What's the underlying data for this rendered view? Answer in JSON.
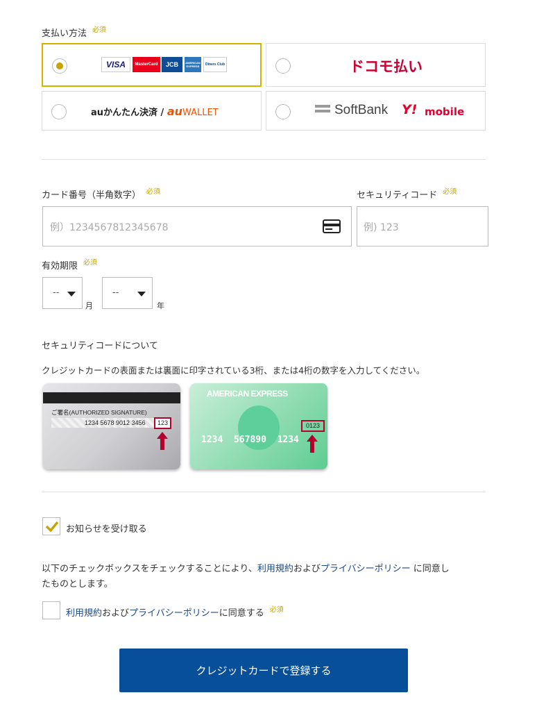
{
  "payment": {
    "title": "支払い方法",
    "required": "必須",
    "options": [
      {
        "id": "credit",
        "logos": [
          "VISA",
          "MasterCard",
          "JCB",
          "AMERICAN EXPRESS",
          "Diners Club"
        ],
        "selected": true
      },
      {
        "id": "docomo",
        "label": "ドコモ払い",
        "selected": false
      },
      {
        "id": "au",
        "label_a": "auかんたん決済 / ",
        "label_b": "au",
        "label_c": "WALLET",
        "selected": false
      },
      {
        "id": "softbank",
        "label_a": "SoftBank",
        "label_b": "Y!",
        "label_c": "mobile",
        "selected": false
      }
    ]
  },
  "card_number": {
    "label": "カード番号（半角数字）",
    "required": "必須",
    "placeholder": "例）1234567812345678"
  },
  "security_code": {
    "label": "セキュリティコード",
    "required": "必須",
    "placeholder": "例) 123"
  },
  "expiry": {
    "label": "有効期限",
    "required": "必須",
    "month_value": "--",
    "month_unit": "月",
    "year_value": "--",
    "year_unit": "年"
  },
  "security_info": {
    "title": "セキュリティコードについて",
    "description": "クレジットカードの表面または裏面に印字されている3桁、または4桁の数字を入力してください。",
    "back_card": {
      "signature": "ご署名(AUTHORIZED SIGNATURE)",
      "number": "1234 5678 9012 3456",
      "code": "123"
    },
    "amex_card": {
      "brand": "AMERICAN EXPRESS",
      "number": "1234  567890  1234",
      "code": "0123"
    }
  },
  "newsletter": {
    "label": "お知らせを受け取る",
    "checked": true
  },
  "agreement": {
    "text_a": "以下のチェックボックスをチェックすることにより、",
    "terms": "利用規約",
    "and": "および",
    "privacy": "プライバシーポリシー",
    "text_b": " に同意し",
    "text_c": "たものとします。",
    "cb_terms": "利用規約",
    "cb_and": "および",
    "cb_privacy": "プライバシーポリシー",
    "cb_suffix": "に同意する",
    "required": "必須",
    "checked": false
  },
  "submit": {
    "label": "クレジットカードで登録する"
  },
  "colors": {
    "accent": "#c9a400",
    "primary": "#084f9a",
    "link": "#1a4a8c",
    "docomo": "#cc0033"
  }
}
